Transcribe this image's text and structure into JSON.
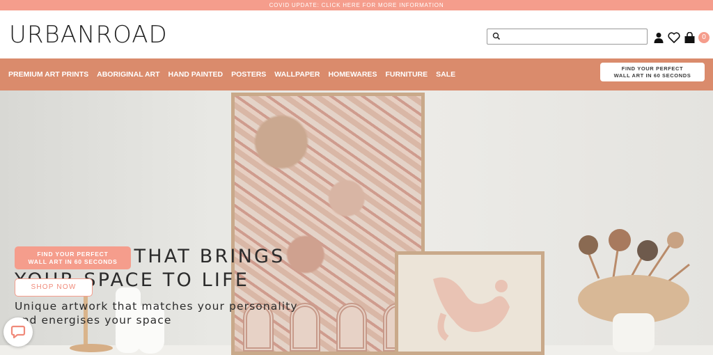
{
  "announcement": {
    "text": "COVID UPDATE: CLICK HERE FOR MORE INFORMATION"
  },
  "header": {
    "logo_text": "URBANROAD",
    "search": {
      "placeholder": "",
      "value": ""
    },
    "icons": [
      "search-icon",
      "account-icon",
      "wishlist-heart-icon",
      "cart-bag-icon"
    ],
    "cart_count": "0"
  },
  "nav": {
    "items": [
      {
        "label": "PREMIUM ART PRINTS"
      },
      {
        "label": "ABORIGINAL ART"
      },
      {
        "label": "HAND PAINTED"
      },
      {
        "label": "POSTERS"
      },
      {
        "label": "WALLPAPER"
      },
      {
        "label": "HOMEWARES"
      },
      {
        "label": "FURNITURE"
      },
      {
        "label": "SALE"
      }
    ],
    "cta_line1": "FIND YOUR PERFECT",
    "cta_line2": "WALL ART IN 60 SECONDS"
  },
  "hero": {
    "headline_line1": "WALL ART THAT BRINGS",
    "headline_line2": "YOUR SPACE TO LIFE",
    "sub_line1": "Unique artwork that matches your personality",
    "sub_line2": "and energises your space",
    "cta_line1": "FIND YOUR PERFECT",
    "cta_line2": "WALL ART IN 60 SECONDS",
    "shop_label": "SHOP NOW"
  },
  "colors": {
    "announcement_bg": "#f59d8c",
    "nav_bg": "#da8b6c",
    "accent": "#f59d8c"
  }
}
